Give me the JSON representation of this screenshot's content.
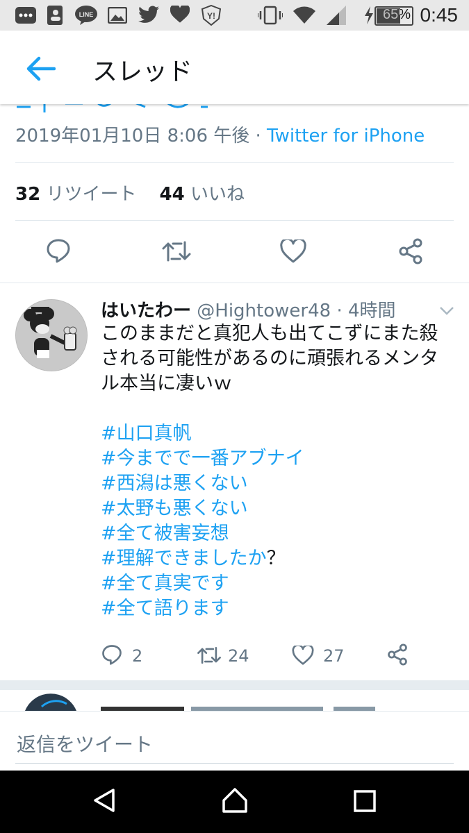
{
  "status_bar": {
    "time": "0:45",
    "battery_percent": "65%",
    "left_icons": [
      "dots-icon",
      "contacts-icon",
      "line-app-icon",
      "image-icon",
      "twitter-icon",
      "heart-icon",
      "yahoo-icon"
    ],
    "right_icons": [
      "vibrate-icon",
      "wifi-icon",
      "signal-icon",
      "charging-icon",
      "battery-icon"
    ]
  },
  "app_bar": {
    "title": "スレッド"
  },
  "tweet": {
    "meta_date": "2019年01月10日 8:06 午後 · ",
    "meta_source": "Twitter for iPhone",
    "retweet_count": "32",
    "retweet_label": " リツイート",
    "like_count": "44",
    "like_label": " いいね"
  },
  "reply": {
    "name": "はいたわー",
    "handle": "@Hightower48",
    "time": " · 4時間",
    "text_lines": [
      "このままだと真犯人も出てこずにまた殺",
      "される可能性があるのに頑張れるメンタ",
      "ル本当に凄いｗ"
    ],
    "hashtags": [
      "#山口真帆",
      "#今までで一番アブナイ",
      "#西潟は悪くない",
      "#太野も悪くない",
      "#全て被害妄想",
      "#理解できましたか",
      "#全て真実です",
      "#全て語ります"
    ],
    "question_mark": "？",
    "replies": "2",
    "retweets": "24",
    "likes": "27"
  },
  "composer": {
    "placeholder": "返信をツイート"
  },
  "colors": {
    "accent": "#1da1f2",
    "secondary_text": "#657786",
    "primary_text": "#14171a",
    "divider": "#e1e8ed"
  }
}
